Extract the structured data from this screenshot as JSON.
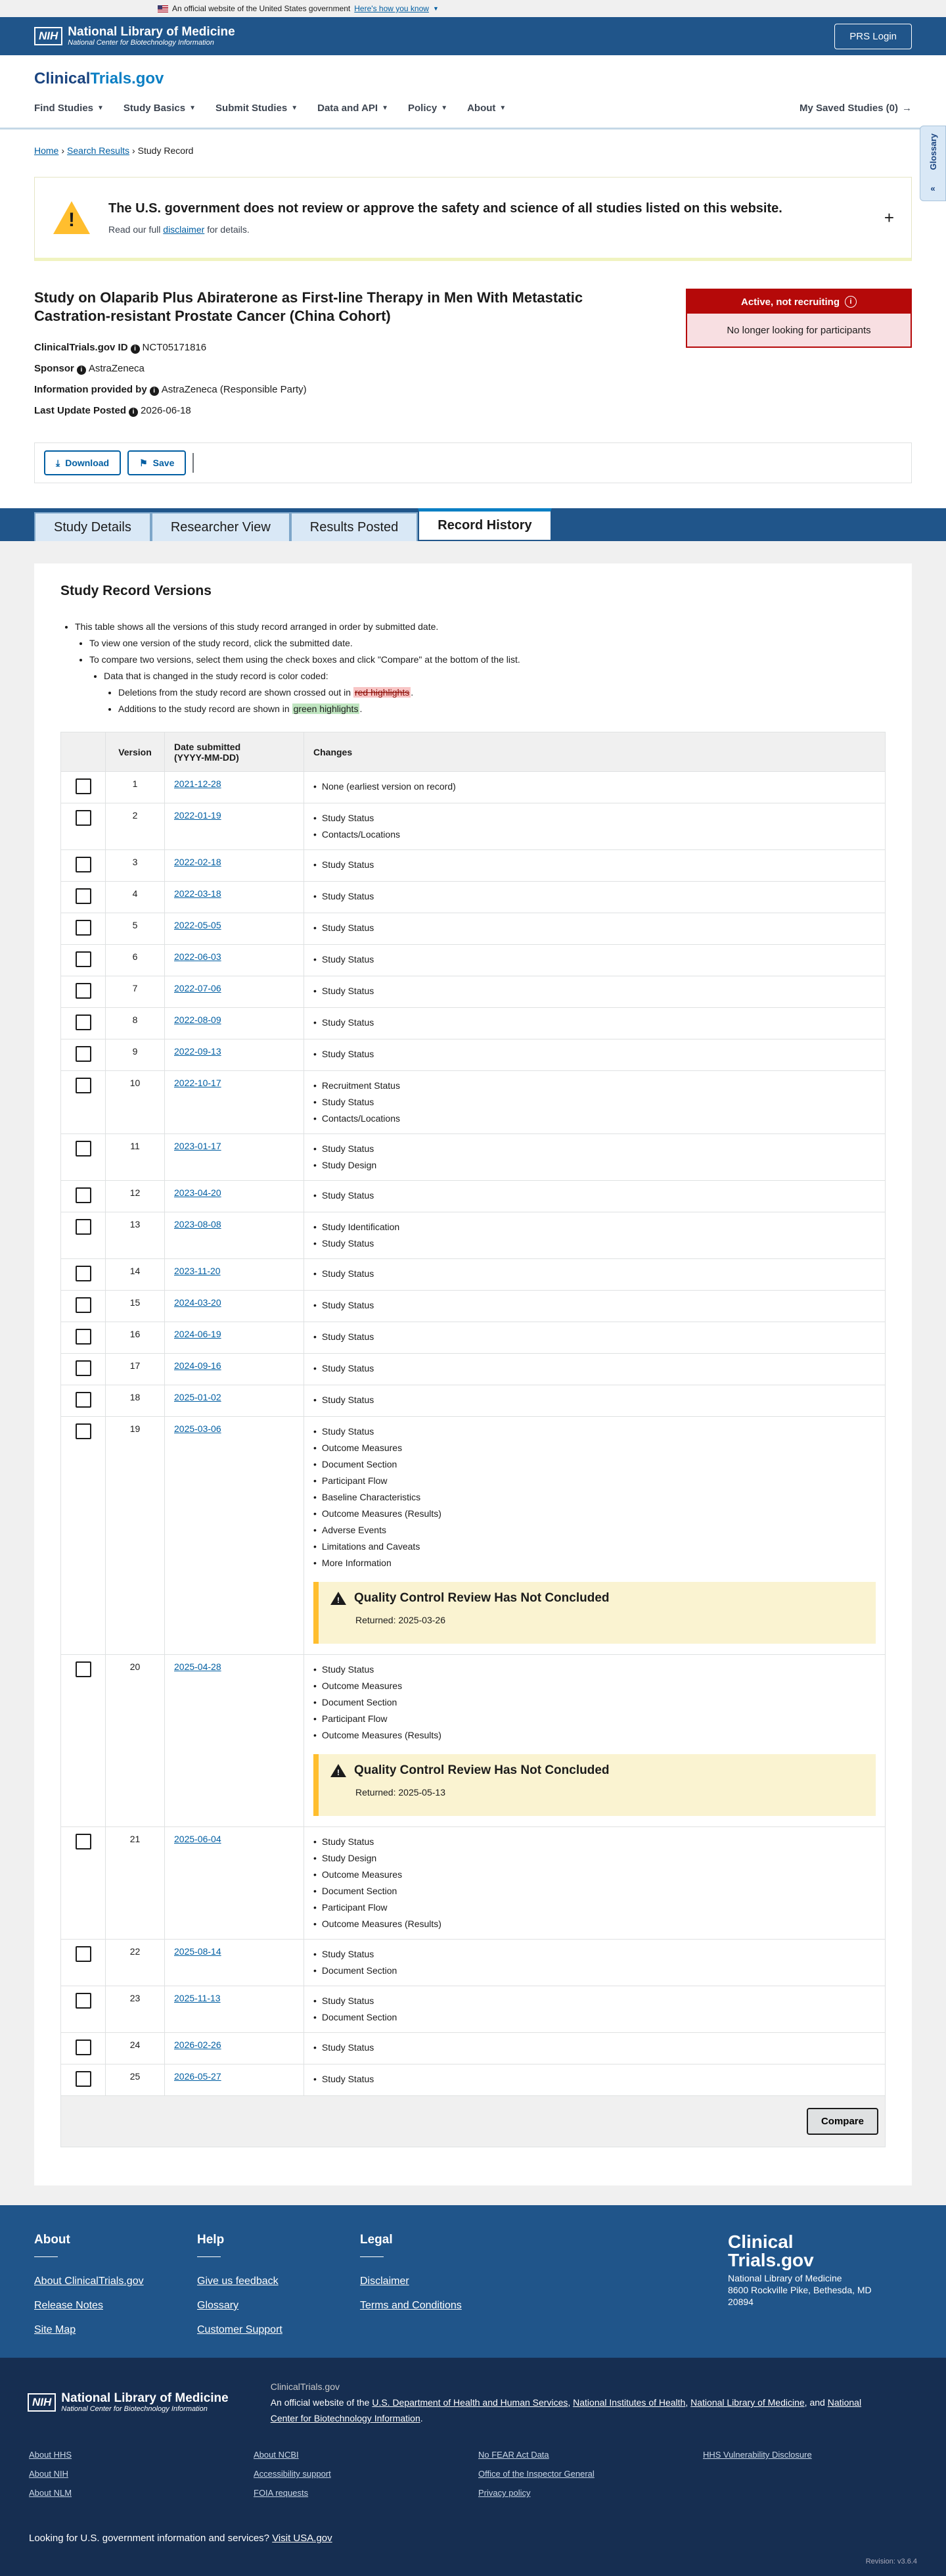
{
  "gov_banner": {
    "text": "An official website of the United States government",
    "link": "Here's how you know"
  },
  "nlm": {
    "logo": "NIH",
    "title": "National Library of Medicine",
    "subtitle": "National Center for Biotechnology Information",
    "prs_login": "PRS Login"
  },
  "header": {
    "logo_a": "Clinical",
    "logo_b": "Trials.gov",
    "nav": [
      "Find Studies",
      "Study Basics",
      "Submit Studies",
      "Data and API",
      "Policy",
      "About"
    ],
    "saved": "My Saved Studies (0)"
  },
  "breadcrumb": {
    "home": "Home",
    "search": "Search Results",
    "current": "Study Record"
  },
  "glossary": "Glossary",
  "alert": {
    "title": "The U.S. government does not review or approve the safety and science of all studies listed on this website.",
    "pre": "Read our full",
    "link": "disclaimer",
    "post": "for details."
  },
  "study": {
    "title": "Study on Olaparib Plus Abiraterone as First-line Therapy in Men With Metastatic Castration-resistant Prostate Cancer (China Cohort)",
    "id_label": "ClinicalTrials.gov ID",
    "id": "NCT05171816",
    "sponsor_label": "Sponsor",
    "sponsor": "AstraZeneca",
    "provided_label": "Information provided by",
    "provided": "AstraZeneca (Responsible Party)",
    "updated_label": "Last Update Posted",
    "updated": "2026-06-18",
    "status": "Active, not recruiting",
    "status_sub": "No longer looking for participants"
  },
  "actions": {
    "download": "Download",
    "save": "Save"
  },
  "tabs": [
    "Study Details",
    "Researcher View",
    "Results Posted",
    "Record History"
  ],
  "versions": {
    "title": "Study Record Versions",
    "intro1": "This table shows all the versions of this study record arranged in order by submitted date.",
    "intro2": "To view one version of the study record, click the submitted date.",
    "intro3": "To compare two versions, select them using the check boxes and click \"Compare\" at the bottom of the list.",
    "intro4": "Data that is changed in the study record is color coded:",
    "del_pre": "Deletions from the study record are shown crossed out in",
    "del_mark": "red highlights",
    "add_pre": "Additions to the study record are shown in",
    "add_mark": "green highlights",
    "col_version": "Version",
    "col_date": "Date submitted",
    "col_date_fmt": "(YYYY-MM-DD)",
    "col_changes": "Changes",
    "compare": "Compare",
    "qc_title": "Quality Control Review Has Not Concluded",
    "rows": [
      {
        "v": "1",
        "d": "2021-12-28",
        "c": [
          "None (earliest version on record)"
        ]
      },
      {
        "v": "2",
        "d": "2022-01-19",
        "c": [
          "Study Status",
          "Contacts/Locations"
        ]
      },
      {
        "v": "3",
        "d": "2022-02-18",
        "c": [
          "Study Status"
        ]
      },
      {
        "v": "4",
        "d": "2022-03-18",
        "c": [
          "Study Status"
        ]
      },
      {
        "v": "5",
        "d": "2022-05-05",
        "c": [
          "Study Status"
        ]
      },
      {
        "v": "6",
        "d": "2022-06-03",
        "c": [
          "Study Status"
        ]
      },
      {
        "v": "7",
        "d": "2022-07-06",
        "c": [
          "Study Status"
        ]
      },
      {
        "v": "8",
        "d": "2022-08-09",
        "c": [
          "Study Status"
        ]
      },
      {
        "v": "9",
        "d": "2022-09-13",
        "c": [
          "Study Status"
        ]
      },
      {
        "v": "10",
        "d": "2022-10-17",
        "c": [
          "Recruitment Status",
          "Study Status",
          "Contacts/Locations"
        ]
      },
      {
        "v": "11",
        "d": "2023-01-17",
        "c": [
          "Study Status",
          "Study Design"
        ]
      },
      {
        "v": "12",
        "d": "2023-04-20",
        "c": [
          "Study Status"
        ]
      },
      {
        "v": "13",
        "d": "2023-08-08",
        "c": [
          "Study Identification",
          "Study Status"
        ]
      },
      {
        "v": "14",
        "d": "2023-11-20",
        "c": [
          "Study Status"
        ]
      },
      {
        "v": "15",
        "d": "2024-03-20",
        "c": [
          "Study Status"
        ]
      },
      {
        "v": "16",
        "d": "2024-06-19",
        "c": [
          "Study Status"
        ]
      },
      {
        "v": "17",
        "d": "2024-09-16",
        "c": [
          "Study Status"
        ]
      },
      {
        "v": "18",
        "d": "2025-01-02",
        "c": [
          "Study Status"
        ]
      },
      {
        "v": "19",
        "d": "2025-03-06",
        "c": [
          "Study Status",
          "Outcome Measures",
          "Document Section",
          "Participant Flow",
          "Baseline Characteristics",
          "Outcome Measures (Results)",
          "Adverse Events",
          "Limitations and Caveats",
          "More Information"
        ],
        "qc": "Returned: 2025-03-26"
      },
      {
        "v": "20",
        "d": "2025-04-28",
        "c": [
          "Study Status",
          "Outcome Measures",
          "Document Section",
          "Participant Flow",
          "Outcome Measures (Results)"
        ],
        "qc": "Returned: 2025-05-13"
      },
      {
        "v": "21",
        "d": "2025-06-04",
        "c": [
          "Study Status",
          "Study Design",
          "Outcome Measures",
          "Document Section",
          "Participant Flow",
          "Outcome Measures (Results)"
        ]
      },
      {
        "v": "22",
        "d": "2025-08-14",
        "c": [
          "Study Status",
          "Document Section"
        ]
      },
      {
        "v": "23",
        "d": "2025-11-13",
        "c": [
          "Study Status",
          "Document Section"
        ]
      },
      {
        "v": "24",
        "d": "2026-02-26",
        "c": [
          "Study Status"
        ]
      },
      {
        "v": "25",
        "d": "2026-05-27",
        "c": [
          "Study Status"
        ]
      }
    ]
  },
  "footer": {
    "cols": [
      {
        "title": "About",
        "links": [
          "About ClinicalTrials.gov",
          "Release Notes",
          "Site Map"
        ]
      },
      {
        "title": "Help",
        "links": [
          "Give us feedback",
          "Glossary",
          "Customer Support"
        ]
      },
      {
        "title": "Legal",
        "links": [
          "Disclaimer",
          "Terms and Conditions"
        ]
      }
    ],
    "logo_a": "Clinical",
    "logo_b": "Trials.gov",
    "addr1": "National Library of Medicine",
    "addr2": "8600 Rockville Pike, Bethesda, MD",
    "addr3": "20894"
  },
  "footer2": {
    "site": "ClinicalTrials.gov",
    "desc_pre": "An official website of the",
    "hhs": "U.S. Department of Health and Human Services",
    "nih": "National Institutes of Health",
    "nlm": "National Library of Medicine",
    "and": "and",
    "ncbi": "National Center for Biotechnology Information",
    "links": [
      "About HHS",
      "About NCBI",
      "No FEAR Act Data",
      "HHS Vulnerability Disclosure",
      "About NIH",
      "Accessibility support",
      "Office of the Inspector General",
      "",
      "About NLM",
      "FOIA requests",
      "Privacy policy",
      ""
    ],
    "usa_pre": "Looking for U.S. government information and services?",
    "usa": "Visit USA.gov",
    "revision": "Revision: v3.6.4"
  }
}
